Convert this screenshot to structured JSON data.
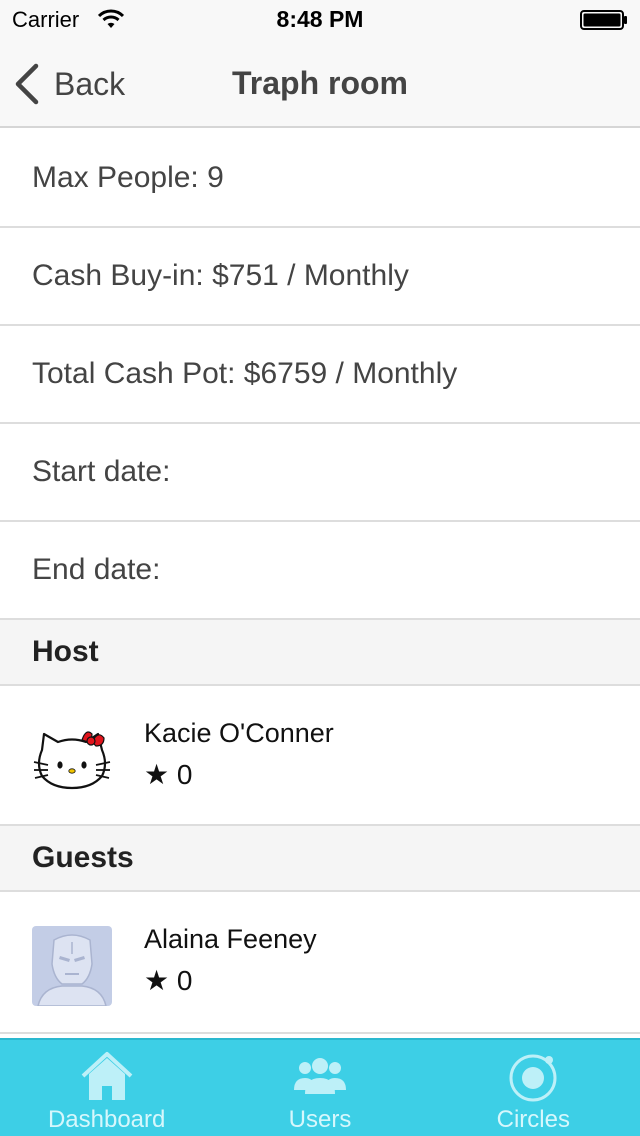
{
  "status_bar": {
    "carrier": "Carrier",
    "time": "8:48 PM",
    "wifi_icon": "wifi-icon",
    "battery_icon": "battery-icon"
  },
  "nav": {
    "back_label": "Back",
    "title": "Traph room"
  },
  "details": {
    "max_people": "Max People: 9",
    "cash_buy_in": "Cash Buy-in: $751 / Monthly",
    "total_cash_pot": "Total Cash Pot: $6759 / Monthly",
    "start_date": "Start date:",
    "end_date": "End date:"
  },
  "host": {
    "header": "Host",
    "name": "Kacie O'Conner",
    "rating": "★ 0",
    "avatar_icon": "hello-kitty-avatar"
  },
  "guests": {
    "header": "Guests",
    "items": [
      {
        "name": "Alaina Feeney",
        "rating": "★ 0",
        "avatar_icon": "iron-man-avatar"
      }
    ]
  },
  "tabs": [
    {
      "label": "Dashboard",
      "icon": "home-icon"
    },
    {
      "label": "Users",
      "icon": "users-icon"
    },
    {
      "label": "Circles",
      "icon": "circle-icon"
    }
  ],
  "colors": {
    "tab_bar": "#3dcfe6",
    "tab_icon": "#d6f7fc",
    "nav_background": "#f8f8f8",
    "text": "#444444"
  }
}
